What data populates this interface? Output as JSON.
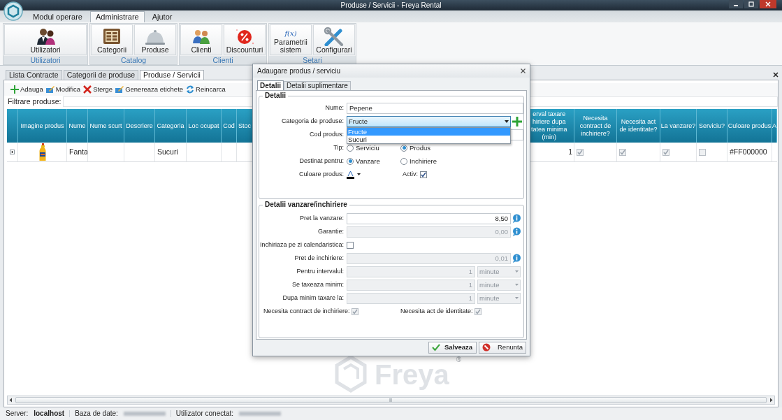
{
  "window": {
    "title": "Produse / Servicii - Freya Rental"
  },
  "menu_tabs": [
    {
      "label": "Modul operare",
      "selected": false
    },
    {
      "label": "Administrare",
      "selected": true
    },
    {
      "label": "Ajutor",
      "selected": false
    }
  ],
  "ribbon_groups": [
    {
      "label": "Utilizatori",
      "buttons": [
        {
          "label": "Utilizatori",
          "kind": "users"
        }
      ]
    },
    {
      "label": "Catalog",
      "buttons": [
        {
          "label": "Categorii",
          "kind": "categories"
        },
        {
          "label": "Produse",
          "kind": "products"
        }
      ]
    },
    {
      "label": "Clienti",
      "buttons": [
        {
          "label": "Clienti",
          "kind": "clients"
        },
        {
          "label": "Discounturi",
          "kind": "discounts"
        }
      ]
    },
    {
      "label": "Setari",
      "buttons": [
        {
          "label": "Parametrii sistem",
          "kind": "function",
          "icon_text": "f(x)"
        },
        {
          "label": "Configurari",
          "kind": "tools"
        }
      ]
    }
  ],
  "document_tabs": [
    {
      "label": "Lista Contracte",
      "selected": false
    },
    {
      "label": "Categorii de produse",
      "selected": false
    },
    {
      "label": "Produse / Servicii",
      "selected": true
    }
  ],
  "toolbar": [
    {
      "label": "Adauga",
      "kind": "add"
    },
    {
      "label": "Modifica",
      "kind": "edit"
    },
    {
      "label": "Sterge",
      "kind": "delete"
    },
    {
      "label": "Genereaza etichete",
      "kind": "edit"
    },
    {
      "label": "Reincarca",
      "kind": "reload"
    }
  ],
  "filter": {
    "label": "Filtrare produse:"
  },
  "table": {
    "columns": [
      "Imagine produs",
      "Nume",
      "Nume scurt",
      "Descriere",
      "Categoria",
      "Loc ocupat",
      "Cod",
      "Stoc",
      "erval taxare\nhiriere dupa\ntatea minima\n(min)",
      "Necesita contract de inchiriere?",
      "Necesita act de identitate?",
      "La vanzare?",
      "Serviciu?",
      "Culoare produs",
      "A"
    ],
    "rows": [
      {
        "expanded": false,
        "cells": [
          {
            "kind": "picture"
          },
          {
            "kind": "text",
            "text": "Fanta"
          },
          {
            "kind": "empty"
          },
          {
            "kind": "empty"
          },
          {
            "kind": "text",
            "text": "Sucuri"
          },
          {
            "kind": "empty"
          },
          {
            "kind": "empty"
          },
          {
            "kind": "empty"
          },
          {
            "kind": "number",
            "text": "1"
          },
          {
            "kind": "check",
            "checked": true,
            "disabled": true
          },
          {
            "kind": "check",
            "checked": true,
            "disabled": true
          },
          {
            "kind": "check",
            "checked": true,
            "disabled": true
          },
          {
            "kind": "check",
            "checked": false,
            "disabled": true
          },
          {
            "kind": "text",
            "text": "#FF000000"
          }
        ]
      }
    ]
  },
  "dialog": {
    "title": "Adaugare produs / serviciu",
    "tabs": [
      {
        "label": "Detalii",
        "selected": true
      },
      {
        "label": "Detalii suplimentare",
        "selected": false
      }
    ],
    "details": {
      "legend": "Detalii",
      "name": {
        "label": "Nume:",
        "value": "Pepene"
      },
      "category": {
        "label": "Categoria de produse:",
        "value": "Fructe",
        "expanded": true,
        "options": [
          {
            "label": "Fructe",
            "selected": true
          },
          {
            "label": "Sucuri",
            "selected": false
          }
        ]
      },
      "code": {
        "label": "Cod produs:"
      },
      "type": {
        "label": "Tip:",
        "options": [
          {
            "label": "Serviciu",
            "selected": false
          },
          {
            "label": "Produs",
            "selected": true
          }
        ]
      },
      "purpose": {
        "label": "Destinat pentru:",
        "options": [
          {
            "label": "Vanzare",
            "selected": true
          },
          {
            "label": "Inchiriere",
            "selected": false
          }
        ]
      },
      "color": {
        "label": "Culoare produs:"
      },
      "active": {
        "label": "Activ:",
        "checked": true
      }
    },
    "sales": {
      "legend": "Detalii vanzare/inchiriere",
      "rows": [
        {
          "kind": "amount",
          "label": "Pret la vanzare:",
          "value": "8,50",
          "disabled": false
        },
        {
          "kind": "amount",
          "label": "Garantie:",
          "value": "0,00",
          "disabled": true
        },
        {
          "kind": "checkbox",
          "label": "Inchiriaza pe zi calendaristica:",
          "checked": false,
          "disabled": false
        },
        {
          "kind": "amount",
          "label": "Pret de inchiriere:",
          "value": "0,01",
          "disabled": true
        },
        {
          "kind": "interval",
          "label": "Pentru intervalul:",
          "value": "1",
          "unit": "minute",
          "disabled": true
        },
        {
          "kind": "interval",
          "label": "Se taxeaza minim:",
          "value": "1",
          "unit": "minute",
          "disabled": true
        },
        {
          "kind": "interval",
          "label": "Dupa minim taxare la:",
          "value": "1",
          "unit": "minute",
          "disabled": true
        }
      ],
      "requirements": [
        {
          "label": "Necesita contract de inchiriere:",
          "checked": true,
          "disabled": true
        },
        {
          "label": "Necesita act de identitate:",
          "checked": true,
          "disabled": true
        }
      ]
    },
    "buttons": [
      {
        "label": "Salveaza",
        "kind": "save"
      },
      {
        "label": "Renunta",
        "kind": "cancel"
      }
    ]
  },
  "status_bar": [
    {
      "label": "Server:",
      "value": "localhost"
    },
    {
      "label": "Baza de date:",
      "redacted": true
    },
    {
      "label": "Utilizator conectat:",
      "redacted": true
    }
  ],
  "background_logo": {
    "text": "Freya",
    "mark": "®"
  }
}
